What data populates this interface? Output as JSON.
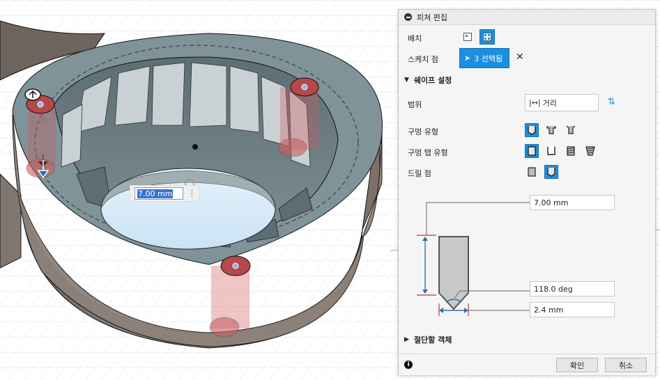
{
  "viewport": {
    "dimension_value": "7.00 mm",
    "ghost_dimension": "7.00"
  },
  "panel": {
    "title": "피쳐 편집",
    "placement_label": "배치",
    "sketch_points_label": "스케치 점",
    "sketch_points_value": "3 선택됨",
    "shape_settings_label": "쉐이프 설정",
    "extent_label": "범위",
    "extent_value": "거리",
    "hole_type_label": "구멍 유형",
    "hole_tap_type_label": "구멍 탭 유형",
    "drill_point_label": "드릴 점",
    "depth_value": "7.00 mm",
    "angle_value": "118.0 deg",
    "diameter_value": "2.4 mm",
    "objects_to_cut_label": "절단할 객체",
    "ok_label": "확인",
    "cancel_label": "취소"
  },
  "colors": {
    "accent": "#1d8fe0",
    "body_top": "#7f9399",
    "body_side": "#8d8279",
    "hole_marker": "#b5484b"
  },
  "icons": {
    "collapse": "collapse-circle-icon",
    "close": "close-x-icon",
    "info": "info-icon",
    "flip": "flip-direction-icon"
  }
}
